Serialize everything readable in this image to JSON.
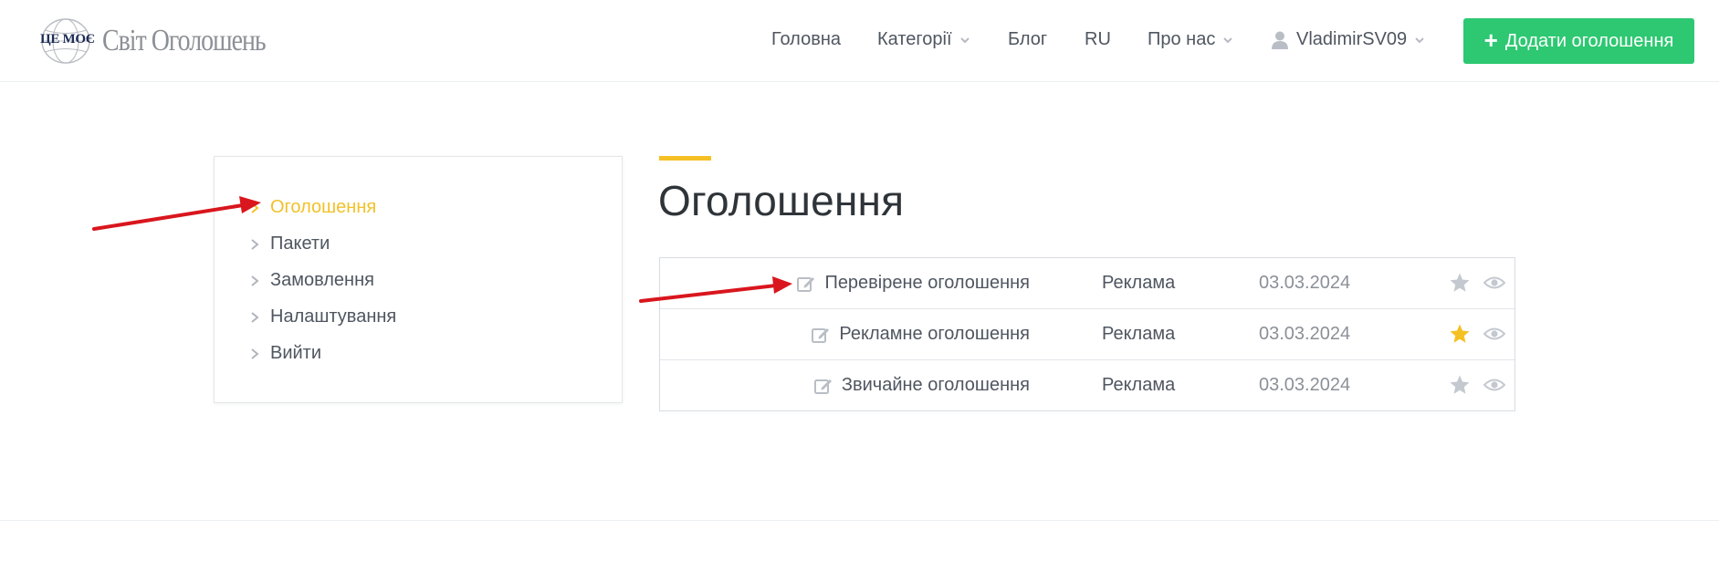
{
  "header": {
    "logo_emblem": "ЦЕ МОЄ",
    "logo_title": "Світ Оголошень",
    "nav": [
      {
        "label": "Головна",
        "dropdown": false
      },
      {
        "label": "Категорії",
        "dropdown": true
      },
      {
        "label": "Блог",
        "dropdown": false
      },
      {
        "label": "RU",
        "dropdown": false
      },
      {
        "label": "Про нас",
        "dropdown": true
      }
    ],
    "user": {
      "name": "VladimirSV09",
      "icon": "user-icon",
      "dropdown": true
    },
    "add_button": {
      "label": "Додати оголошення",
      "icon": "plus-icon",
      "color": "#2dc871"
    }
  },
  "sidebar": {
    "items": [
      {
        "label": "Оголошення",
        "active": true
      },
      {
        "label": "Пакети",
        "active": false
      },
      {
        "label": "Замовлення",
        "active": false
      },
      {
        "label": "Налаштування",
        "active": false
      },
      {
        "label": "Вийти",
        "active": false
      }
    ],
    "active_color": "#f2c12a"
  },
  "main": {
    "title": "Оголошення",
    "accent_color": "#f5c024",
    "ads": [
      {
        "title": "Перевірене оголошення",
        "category": "Реклама",
        "date": "03.03.2024",
        "starred": false
      },
      {
        "title": "Рекламне оголошення",
        "category": "Реклама",
        "date": "03.03.2024",
        "starred": true
      },
      {
        "title": "Звичайне оголошення",
        "category": "Реклама",
        "date": "03.03.2024",
        "starred": false
      }
    ],
    "star_active_color": "#f5c024",
    "star_inactive_color": "#c4c9d0"
  },
  "annotations": {
    "arrow_color": "#d9161d"
  }
}
